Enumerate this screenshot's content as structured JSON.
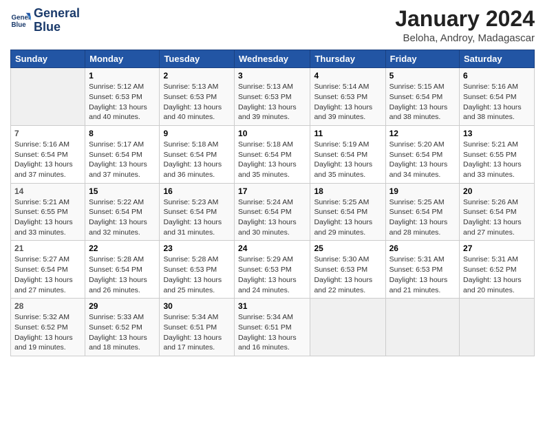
{
  "header": {
    "logo_line1": "General",
    "logo_line2": "Blue",
    "title": "January 2024",
    "subtitle": "Beloha, Androy, Madagascar"
  },
  "weekdays": [
    "Sunday",
    "Monday",
    "Tuesday",
    "Wednesday",
    "Thursday",
    "Friday",
    "Saturday"
  ],
  "weeks": [
    [
      {
        "num": "",
        "info": ""
      },
      {
        "num": "1",
        "info": "Sunrise: 5:12 AM\nSunset: 6:53 PM\nDaylight: 13 hours\nand 40 minutes."
      },
      {
        "num": "2",
        "info": "Sunrise: 5:13 AM\nSunset: 6:53 PM\nDaylight: 13 hours\nand 40 minutes."
      },
      {
        "num": "3",
        "info": "Sunrise: 5:13 AM\nSunset: 6:53 PM\nDaylight: 13 hours\nand 39 minutes."
      },
      {
        "num": "4",
        "info": "Sunrise: 5:14 AM\nSunset: 6:53 PM\nDaylight: 13 hours\nand 39 minutes."
      },
      {
        "num": "5",
        "info": "Sunrise: 5:15 AM\nSunset: 6:54 PM\nDaylight: 13 hours\nand 38 minutes."
      },
      {
        "num": "6",
        "info": "Sunrise: 5:16 AM\nSunset: 6:54 PM\nDaylight: 13 hours\nand 38 minutes."
      }
    ],
    [
      {
        "num": "7",
        "info": "Sunrise: 5:16 AM\nSunset: 6:54 PM\nDaylight: 13 hours\nand 37 minutes."
      },
      {
        "num": "8",
        "info": "Sunrise: 5:17 AM\nSunset: 6:54 PM\nDaylight: 13 hours\nand 37 minutes."
      },
      {
        "num": "9",
        "info": "Sunrise: 5:18 AM\nSunset: 6:54 PM\nDaylight: 13 hours\nand 36 minutes."
      },
      {
        "num": "10",
        "info": "Sunrise: 5:18 AM\nSunset: 6:54 PM\nDaylight: 13 hours\nand 35 minutes."
      },
      {
        "num": "11",
        "info": "Sunrise: 5:19 AM\nSunset: 6:54 PM\nDaylight: 13 hours\nand 35 minutes."
      },
      {
        "num": "12",
        "info": "Sunrise: 5:20 AM\nSunset: 6:54 PM\nDaylight: 13 hours\nand 34 minutes."
      },
      {
        "num": "13",
        "info": "Sunrise: 5:21 AM\nSunset: 6:55 PM\nDaylight: 13 hours\nand 33 minutes."
      }
    ],
    [
      {
        "num": "14",
        "info": "Sunrise: 5:21 AM\nSunset: 6:55 PM\nDaylight: 13 hours\nand 33 minutes."
      },
      {
        "num": "15",
        "info": "Sunrise: 5:22 AM\nSunset: 6:54 PM\nDaylight: 13 hours\nand 32 minutes."
      },
      {
        "num": "16",
        "info": "Sunrise: 5:23 AM\nSunset: 6:54 PM\nDaylight: 13 hours\nand 31 minutes."
      },
      {
        "num": "17",
        "info": "Sunrise: 5:24 AM\nSunset: 6:54 PM\nDaylight: 13 hours\nand 30 minutes."
      },
      {
        "num": "18",
        "info": "Sunrise: 5:25 AM\nSunset: 6:54 PM\nDaylight: 13 hours\nand 29 minutes."
      },
      {
        "num": "19",
        "info": "Sunrise: 5:25 AM\nSunset: 6:54 PM\nDaylight: 13 hours\nand 28 minutes."
      },
      {
        "num": "20",
        "info": "Sunrise: 5:26 AM\nSunset: 6:54 PM\nDaylight: 13 hours\nand 27 minutes."
      }
    ],
    [
      {
        "num": "21",
        "info": "Sunrise: 5:27 AM\nSunset: 6:54 PM\nDaylight: 13 hours\nand 27 minutes."
      },
      {
        "num": "22",
        "info": "Sunrise: 5:28 AM\nSunset: 6:54 PM\nDaylight: 13 hours\nand 26 minutes."
      },
      {
        "num": "23",
        "info": "Sunrise: 5:28 AM\nSunset: 6:53 PM\nDaylight: 13 hours\nand 25 minutes."
      },
      {
        "num": "24",
        "info": "Sunrise: 5:29 AM\nSunset: 6:53 PM\nDaylight: 13 hours\nand 24 minutes."
      },
      {
        "num": "25",
        "info": "Sunrise: 5:30 AM\nSunset: 6:53 PM\nDaylight: 13 hours\nand 22 minutes."
      },
      {
        "num": "26",
        "info": "Sunrise: 5:31 AM\nSunset: 6:53 PM\nDaylight: 13 hours\nand 21 minutes."
      },
      {
        "num": "27",
        "info": "Sunrise: 5:31 AM\nSunset: 6:52 PM\nDaylight: 13 hours\nand 20 minutes."
      }
    ],
    [
      {
        "num": "28",
        "info": "Sunrise: 5:32 AM\nSunset: 6:52 PM\nDaylight: 13 hours\nand 19 minutes."
      },
      {
        "num": "29",
        "info": "Sunrise: 5:33 AM\nSunset: 6:52 PM\nDaylight: 13 hours\nand 18 minutes."
      },
      {
        "num": "30",
        "info": "Sunrise: 5:34 AM\nSunset: 6:51 PM\nDaylight: 13 hours\nand 17 minutes."
      },
      {
        "num": "31",
        "info": "Sunrise: 5:34 AM\nSunset: 6:51 PM\nDaylight: 13 hours\nand 16 minutes."
      },
      {
        "num": "",
        "info": ""
      },
      {
        "num": "",
        "info": ""
      },
      {
        "num": "",
        "info": ""
      }
    ]
  ]
}
